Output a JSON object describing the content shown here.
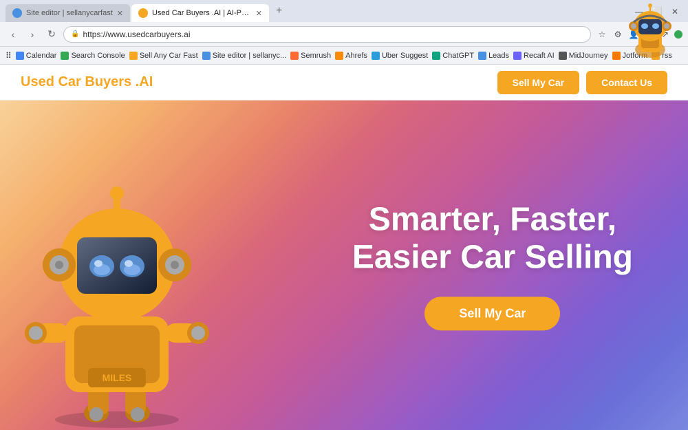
{
  "browser": {
    "tabs": [
      {
        "id": "tab1",
        "label": "Site editor | sellanycarfast",
        "favicon_color": "#4a90e2",
        "active": false
      },
      {
        "id": "tab2",
        "label": "Used Car Buyers .AI | AI-Powe...",
        "favicon_color": "#f5a623",
        "active": true
      }
    ],
    "address": "https://www.usedcarbuyers.ai",
    "window_controls": [
      "minimize",
      "maximize",
      "close"
    ]
  },
  "bookmarks": [
    {
      "label": "Calendar",
      "color": "#4285f4"
    },
    {
      "label": "Search Console",
      "color": "#34a853"
    },
    {
      "label": "Sell Any Car Fast",
      "color": "#f5a623"
    },
    {
      "label": "Site editor | sellanyc...",
      "color": "#4a90e2"
    },
    {
      "label": "Semrush",
      "color": "#ff6b35"
    },
    {
      "label": "Ahrefs",
      "color": "#f98b0b"
    },
    {
      "label": "Uber Suggest",
      "color": "#2d9cdb"
    },
    {
      "label": "ChatGPT",
      "color": "#10a37f"
    },
    {
      "label": "Leads",
      "color": "#4a90e2"
    },
    {
      "label": "Recaft AI",
      "color": "#6c63ff"
    },
    {
      "label": "MidJourney",
      "color": "#333"
    },
    {
      "label": "Jotform",
      "color": "#f67a02"
    },
    {
      "label": "rss",
      "color": "#f5a623"
    }
  ],
  "site": {
    "logo": "Used Car Buyers .AI",
    "header_buttons": {
      "sell": "Sell My Car",
      "contact": "Contact Us"
    },
    "hero": {
      "headline_line1": "Smarter, Faster,",
      "headline_line2": "Easier Car Selling",
      "cta_button": "Sell My Car"
    }
  },
  "colors": {
    "brand_orange": "#f5a623",
    "white": "#ffffff",
    "hero_gradient_start": "#f8d29a",
    "hero_gradient_end": "#7a88e0"
  }
}
